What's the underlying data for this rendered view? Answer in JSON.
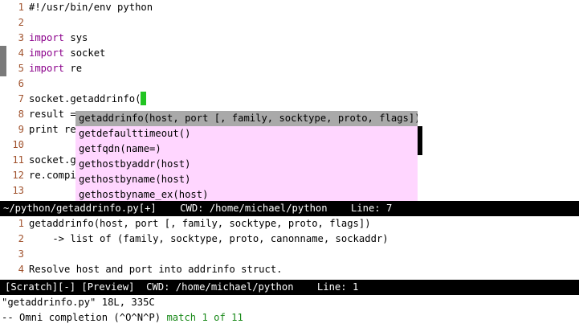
{
  "editor": {
    "lines": [
      {
        "num": "1",
        "text": "#!/usr/bin/env python"
      },
      {
        "num": "2",
        "text": ""
      },
      {
        "num": "3",
        "kw": "import",
        "text": " sys"
      },
      {
        "num": "4",
        "kw": "import",
        "text": " socket"
      },
      {
        "num": "5",
        "kw": "import",
        "text": " re"
      },
      {
        "num": "6",
        "text": ""
      },
      {
        "num": "7",
        "text": "socket.getaddrinfo("
      },
      {
        "num": "8",
        "text": "result = "
      },
      {
        "num": "9",
        "text": "print re"
      },
      {
        "num": "10",
        "text": ""
      },
      {
        "num": "11",
        "text": "socket.g"
      },
      {
        "num": "12",
        "text": "re.compi"
      },
      {
        "num": "13",
        "text": ""
      }
    ]
  },
  "popup": {
    "items": [
      "getaddrinfo(host, port [, family, socktype, proto, flags])",
      "getdefaulttimeout()",
      "getfqdn(name=)",
      "gethostbyaddr(host)",
      "gethostbyname(host)",
      "gethostbyname_ex(host)"
    ],
    "selected_index": 0
  },
  "status1": {
    "file": "~/python/getaddrinfo.py[+]",
    "cwd": "CWD: /home/michael/python",
    "line": "Line: 7"
  },
  "preview": {
    "lines": [
      {
        "num": "1",
        "text": "getaddrinfo(host, port [, family, socktype, proto, flags])"
      },
      {
        "num": "2",
        "text": "    -> list of (family, socktype, proto, canonname, sockaddr)"
      },
      {
        "num": "3",
        "text": ""
      },
      {
        "num": "4",
        "text": "Resolve host and port into addrinfo struct."
      }
    ]
  },
  "status2": {
    "buffers": "[Scratch][-] [Preview]",
    "cwd": "CWD: /home/michael/python",
    "line": "Line: 1"
  },
  "cmdline": {
    "file_info": "\"getaddrinfo.py\" 18L, 335C",
    "completion_prefix": "-- Omni completion (^O^N^P) ",
    "match_text": "match 1 of 11"
  },
  "colors": {
    "line_number": "#a0522d",
    "keyword": "#8b008b",
    "popup_bg": "#ffd6ff",
    "popup_selected": "#a9a9a9",
    "cursor": "#22c422",
    "match": "#1a8a1a"
  }
}
